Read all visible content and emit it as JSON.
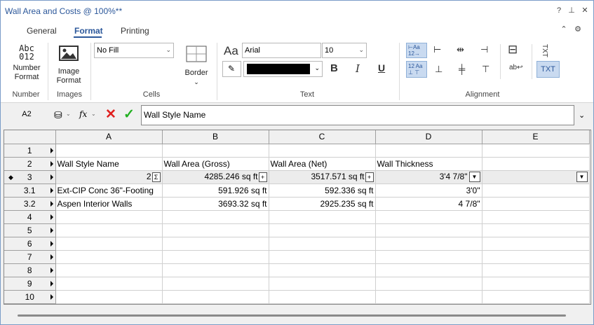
{
  "window": {
    "title": "Wall Area and Costs @ 100%**",
    "help": "?",
    "pin": "⊥",
    "close": "✕"
  },
  "tabs": [
    {
      "label": "General"
    },
    {
      "label": "Format"
    },
    {
      "label": "Printing"
    }
  ],
  "ribbon_extra": {
    "collapse": "⌃",
    "settings": "⚙"
  },
  "ribbon": {
    "number": {
      "icon_text": "Abc\n012",
      "label": "Number Format",
      "group": "Number"
    },
    "images": {
      "label": "Image Format",
      "group": "Images"
    },
    "cells": {
      "fill": "No Fill",
      "border_label": "Border",
      "group": "Cells"
    },
    "text": {
      "font": "Arial",
      "size": "10",
      "bold": "B",
      "italic": "I",
      "underline": "U",
      "group": "Text",
      "color": "#000000"
    },
    "alignment": {
      "group": "Alignment",
      "txt1": "TXT",
      "txt2": "TXT"
    }
  },
  "formula": {
    "cellref": "A2",
    "value": "Wall Style Name",
    "fx": "fx"
  },
  "columns": [
    "A",
    "B",
    "C",
    "D",
    "E"
  ],
  "rows": [
    {
      "hdr": "1",
      "cells": [
        "",
        "",
        "",
        "",
        ""
      ]
    },
    {
      "hdr": "2",
      "cells": [
        "Wall Style Name",
        "Wall Area (Gross)",
        "Wall Area (Net)",
        "Wall Thickness",
        ""
      ]
    },
    {
      "hdr": "3",
      "cells": [
        "2",
        "4285.246 sq ft",
        "3517.571 sq ft",
        "3'4 7/8\"",
        ""
      ]
    },
    {
      "hdr": "3.1",
      "cells": [
        "Ext-CIP Conc 36\"-Footing",
        "591.926 sq ft",
        "592.336 sq ft",
        "3'0\"",
        ""
      ]
    },
    {
      "hdr": "3.2",
      "cells": [
        "Aspen Interior Walls",
        "3693.32 sq ft",
        "2925.235 sq ft",
        "4 7/8\"",
        ""
      ]
    },
    {
      "hdr": "4",
      "cells": [
        "",
        "",
        "",
        "",
        ""
      ]
    },
    {
      "hdr": "5",
      "cells": [
        "",
        "",
        "",
        "",
        ""
      ]
    },
    {
      "hdr": "6",
      "cells": [
        "",
        "",
        "",
        "",
        ""
      ]
    },
    {
      "hdr": "7",
      "cells": [
        "",
        "",
        "",
        "",
        ""
      ]
    },
    {
      "hdr": "8",
      "cells": [
        "",
        "",
        "",
        "",
        ""
      ]
    },
    {
      "hdr": "9",
      "cells": [
        "",
        "",
        "",
        "",
        ""
      ]
    },
    {
      "hdr": "10",
      "cells": [
        "",
        "",
        "",
        "",
        ""
      ]
    }
  ],
  "summary_marks": {
    "sum": "Σ",
    "plus": "+",
    "dd": "▼"
  }
}
